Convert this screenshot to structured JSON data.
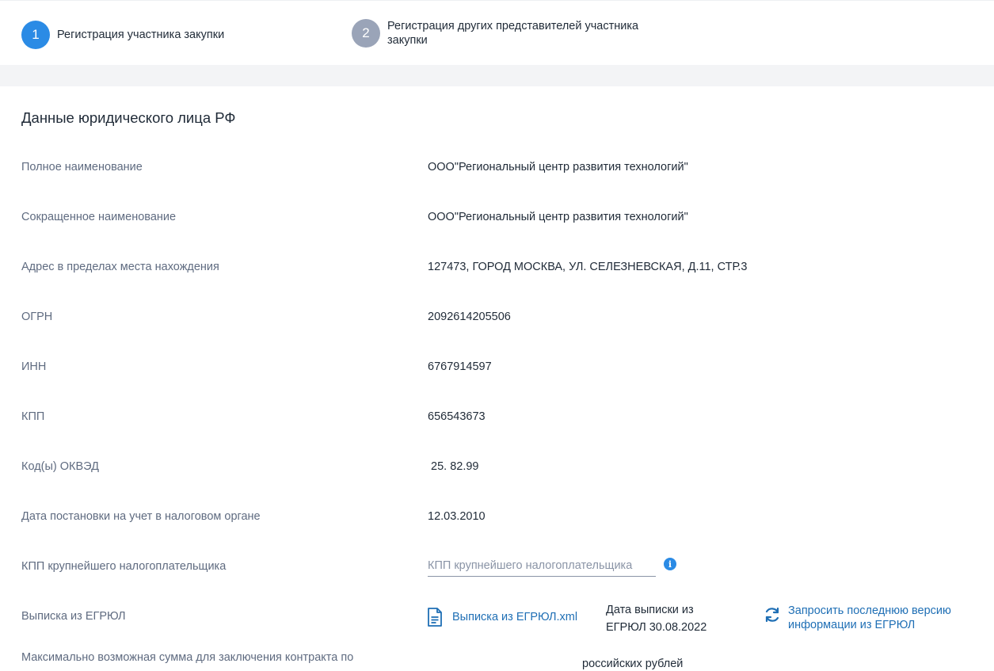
{
  "steps": [
    {
      "number": "1",
      "label": "Регистрация участника закупки"
    },
    {
      "number": "2",
      "label": "Регистрация других представителей участника закупки"
    }
  ],
  "section": {
    "title": "Данные юридического лица РФ"
  },
  "fields": [
    {
      "label": "Полное наименование",
      "value": "ООО\"Региональный центр развития технологий\""
    },
    {
      "label": "Сокращенное наименование",
      "value": "ООО\"Региональный центр развития технологий\""
    },
    {
      "label": "Адрес в пределах места нахождения",
      "value": "127473, ГОРОД МОСКВА, УЛ. СЕЛЕЗНЕВСКАЯ, Д.11, СТР.3"
    },
    {
      "label": "ОГРН",
      "value": "2092614205506"
    },
    {
      "label": "ИНН",
      "value": "6767914597"
    },
    {
      "label": "КПП",
      "value": "656543673"
    },
    {
      "label": "Код(ы) ОКВЭД",
      "value": " 25. 82.99"
    },
    {
      "label": "Дата постановки на учет в налоговом органе",
      "value": "12.03.2010"
    },
    {
      "label": "КПП крупнейшего налогоплательщика",
      "value": ""
    },
    {
      "label": "Выписка из ЕГРЮЛ",
      "value": ""
    },
    {
      "label": "Максимально возможная сумма для заключения контракта по",
      "value": ""
    }
  ],
  "kpp_input": {
    "placeholder": "КПП крупнейшего налогоплательщика",
    "value": ""
  },
  "egrul": {
    "file_label": "Выписка из ЕГРЮЛ.xml",
    "date_text": "Дата выписки из ЕГРЮЛ 30.08.2022",
    "refresh_label": "Запросить последнюю версию информации из ЕГРЮЛ"
  },
  "max_sum": {
    "currency_text": "российских рублей"
  },
  "icons": {
    "info": "info-icon",
    "file": "file-icon",
    "refresh": "refresh-icon"
  },
  "colors": {
    "accent": "#2b8be5",
    "link": "#1f6fb5",
    "step_inactive": "#9aa4b8"
  }
}
